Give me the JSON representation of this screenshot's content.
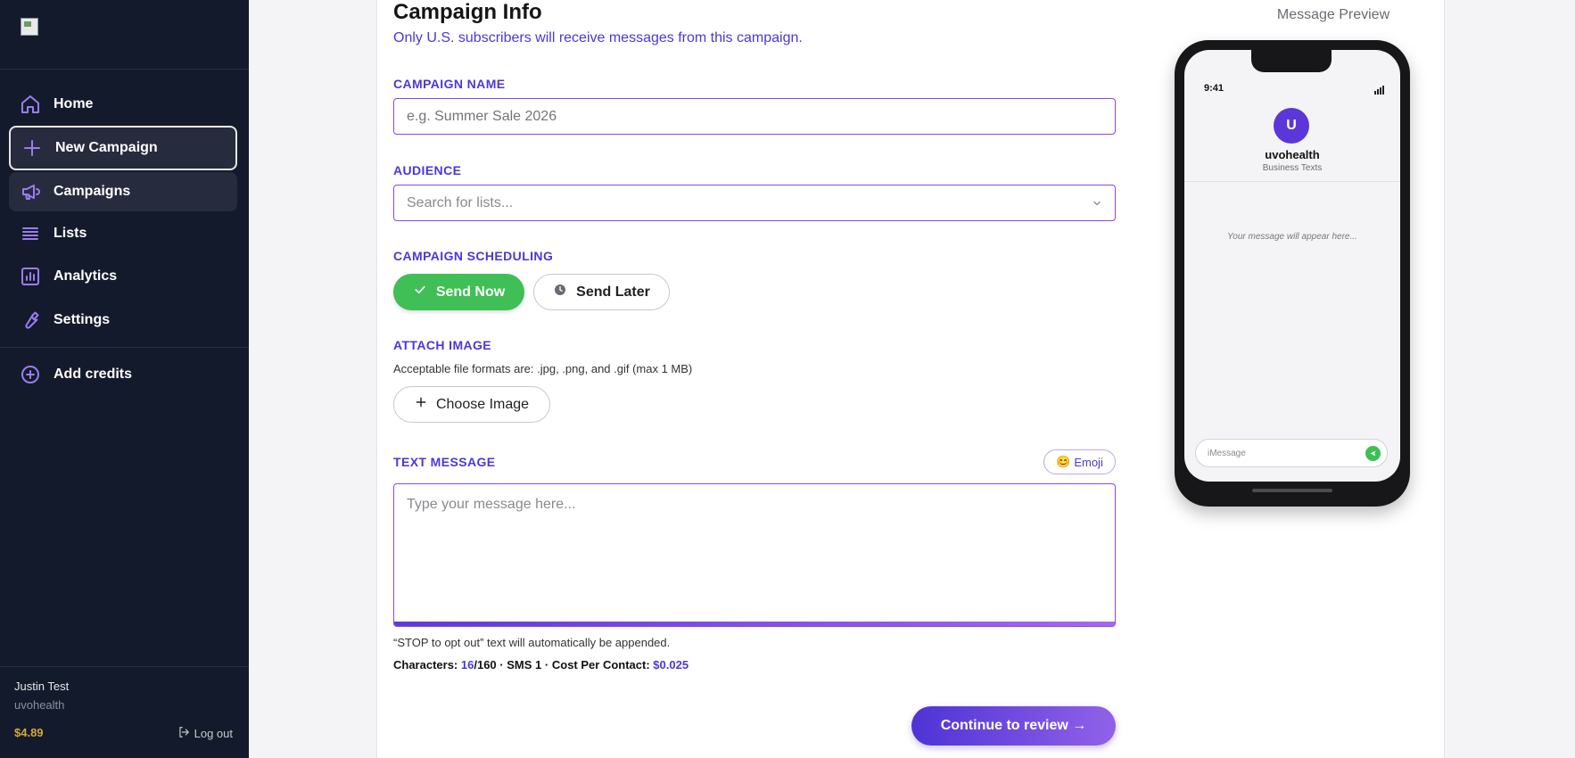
{
  "sidebar": {
    "items": [
      {
        "label": "Home",
        "icon": "home-icon"
      },
      {
        "label": "New Campaign",
        "icon": "plus-icon"
      },
      {
        "label": "Campaigns",
        "icon": "megaphone-icon"
      },
      {
        "label": "Lists",
        "icon": "list-icon"
      },
      {
        "label": "Analytics",
        "icon": "chart-icon"
      },
      {
        "label": "Settings",
        "icon": "wrench-icon"
      },
      {
        "label": "Add credits",
        "icon": "plus-circle-icon"
      }
    ],
    "user": {
      "name": "Justin Test",
      "org": "uvohealth",
      "credits": "$4.89",
      "logout_label": "Log out"
    }
  },
  "form": {
    "title": "Campaign Info",
    "subtitle": "Only U.S. subscribers will receive messages from this campaign.",
    "campaign_name": {
      "label": "CAMPAIGN NAME",
      "placeholder": "e.g. Summer Sale 2026",
      "value": ""
    },
    "audience": {
      "label": "AUDIENCE",
      "placeholder": "Search for lists..."
    },
    "scheduling": {
      "label": "CAMPAIGN SCHEDULING",
      "send_now": "Send Now",
      "send_later": "Send Later"
    },
    "attach": {
      "label": "ATTACH IMAGE",
      "help": "Acceptable file formats are: .jpg, .png, and .gif (max 1 MB)",
      "button": "Choose Image"
    },
    "text_message": {
      "label": "TEXT MESSAGE",
      "emoji_button": "Emoji",
      "emoji_glyph": "😊",
      "placeholder": "Type your message here...",
      "note": "“STOP to opt out” text will automatically be appended.",
      "characters_label": "Characters:",
      "characters_count": "16",
      "characters_max": "/160",
      "sms_label": "SMS 1",
      "cost_label": "Cost Per Contact:",
      "cost_value": "$0.025"
    },
    "continue_label": "Continue to review →"
  },
  "preview": {
    "title": "Message Preview",
    "time": "9:41",
    "avatar_letter": "U",
    "name": "uvohealth",
    "subtitle": "Business Texts",
    "message_placeholder": "Your message will appear here...",
    "input_placeholder": "iMessage"
  },
  "colors": {
    "sidebar_bg": "#131a2b",
    "accent": "#4b38d8",
    "send_now_green": "#3fbf55",
    "credits_gold": "#d4a93a"
  }
}
